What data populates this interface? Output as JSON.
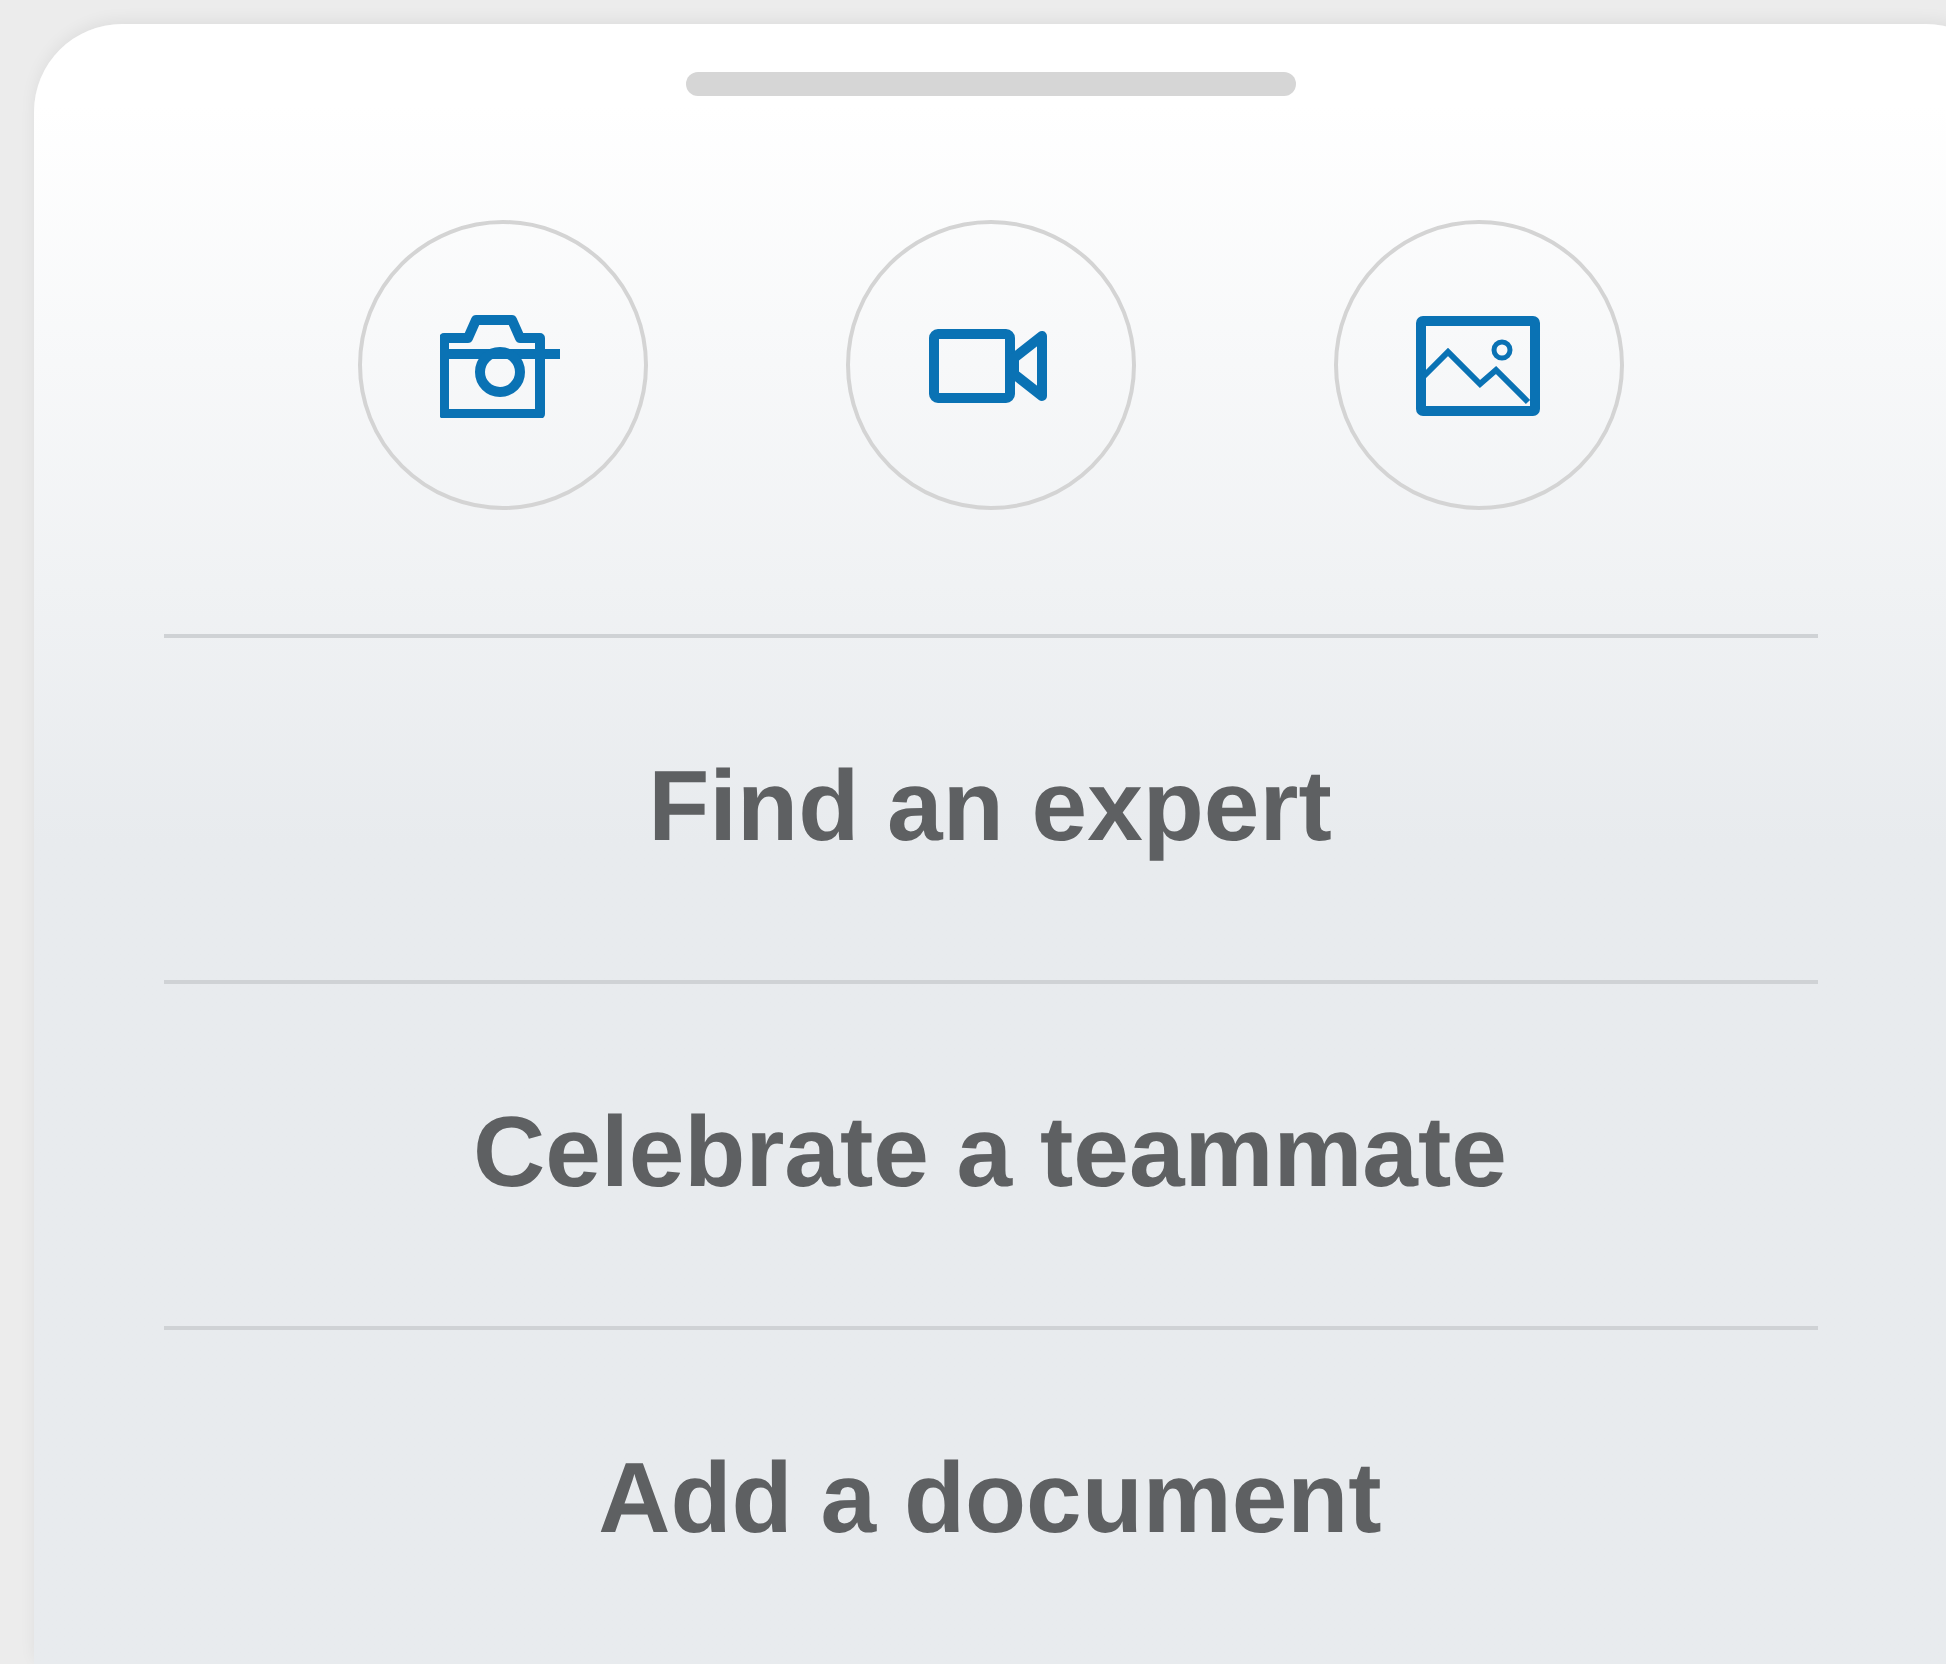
{
  "action_buttons": [
    {
      "kind": "camera"
    },
    {
      "kind": "video"
    },
    {
      "kind": "image"
    }
  ],
  "menu_items": [
    {
      "label": "Find an expert"
    },
    {
      "label": "Celebrate a teammate"
    },
    {
      "label": "Add a document"
    }
  ]
}
